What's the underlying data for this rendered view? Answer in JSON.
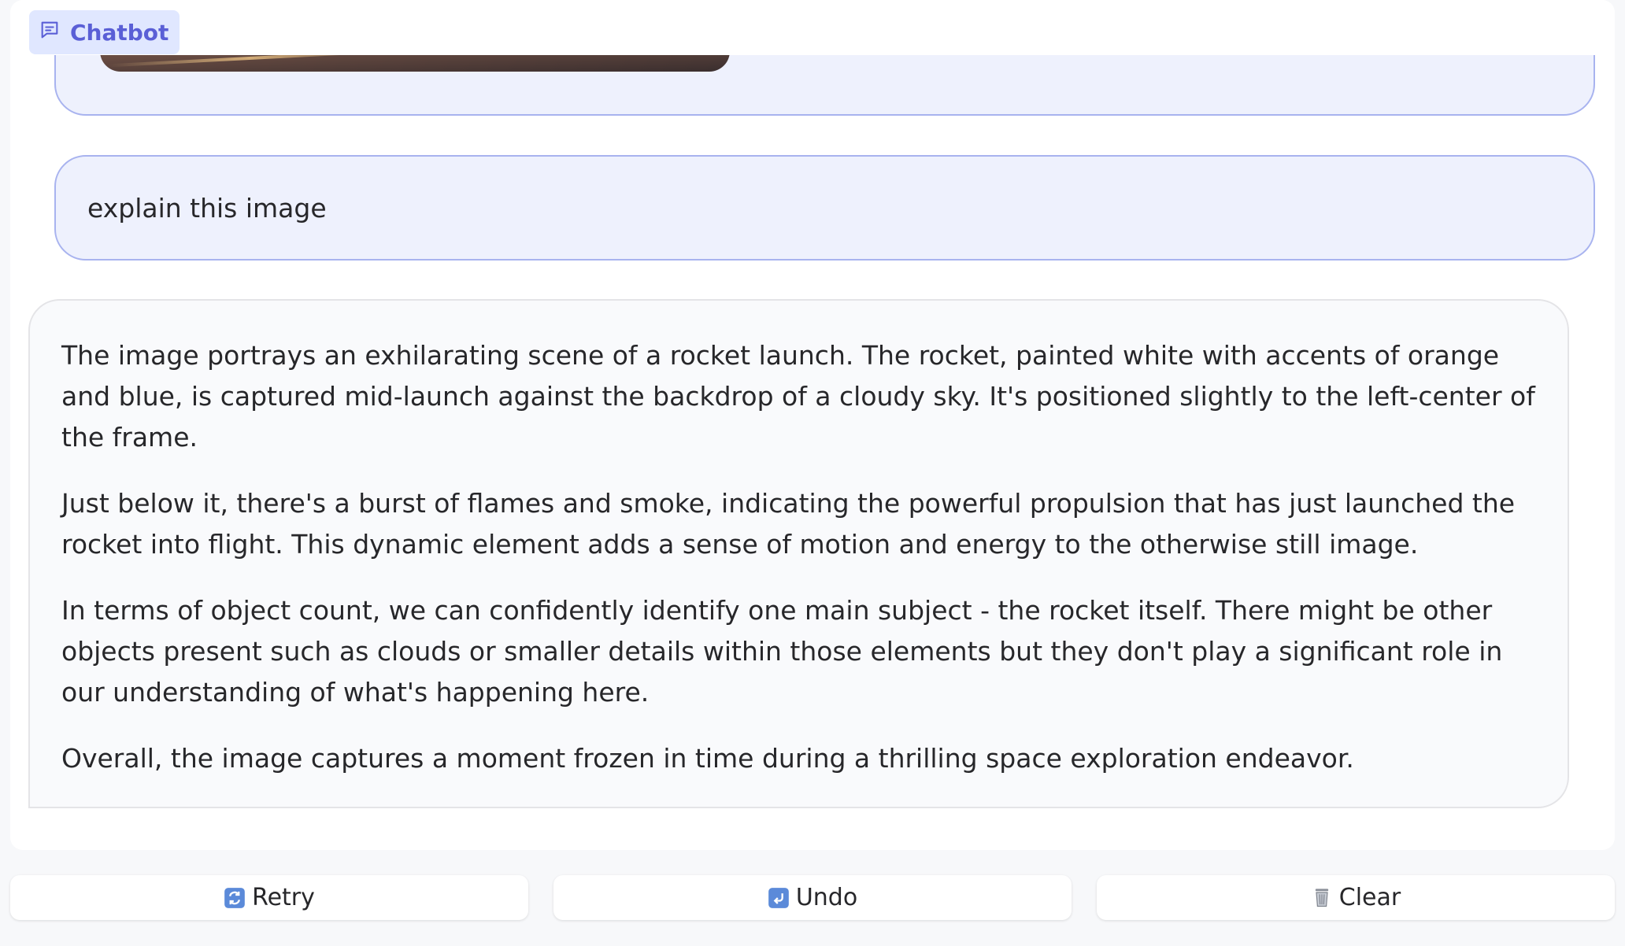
{
  "chatbot": {
    "label": "Chatbot",
    "icon": "chat-icon"
  },
  "messages": [
    {
      "role": "user",
      "type": "image",
      "image_alt": "rocket launch image"
    },
    {
      "role": "user",
      "type": "text",
      "text": "explain this image"
    },
    {
      "role": "bot",
      "type": "text",
      "paragraphs": [
        "The image portrays an exhilarating scene of a rocket launch. The rocket, painted white with accents of orange and blue, is captured mid-launch against the backdrop of a cloudy sky. It's positioned slightly to the left-center of the frame.",
        "Just below it, there's a burst of flames and smoke, indicating the powerful propulsion that has just launched the rocket into flight. This dynamic element adds a sense of motion and energy to the otherwise still image.",
        "In terms of object count, we can confidently identify one main subject - the rocket itself. There might be other objects present such as clouds or smaller details within those elements but they don't play a significant role in our understanding of what's happening here.",
        "Overall, the image captures a moment frozen in time during a thrilling space exploration endeavor."
      ]
    }
  ],
  "buttons": {
    "retry": {
      "label": "Retry",
      "icon": "retry-icon"
    },
    "undo": {
      "label": "Undo",
      "icon": "undo-icon"
    },
    "clear": {
      "label": "Clear",
      "icon": "trash-icon"
    }
  },
  "colors": {
    "accent": "#5a5fd6",
    "user_bubble_bg": "#eef1fd",
    "user_bubble_border": "#a8b3ef",
    "bot_bubble_bg": "#f9fafc"
  }
}
